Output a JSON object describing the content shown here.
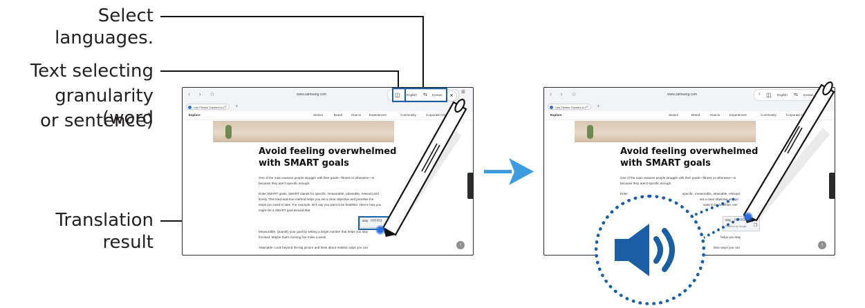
{
  "callouts": {
    "select_languages": "Select languages.",
    "granularity_line1": "Text selecting",
    "granularity_line2": "granularity (word",
    "granularity_line3": "or sentence)",
    "translation_result": "Translation result"
  },
  "colors": {
    "accent": "#1a5fa3",
    "arrow": "#3d9be0",
    "highlight": "#2c6fe0"
  },
  "browser": {
    "url": "www.samsung.com",
    "tab_title": "Use Fitness Trackers to F...",
    "menu": {
      "explore": "Explore",
      "items": [
        "Stories",
        "Brand",
        "How-to",
        "Experiences",
        "Community",
        "Corporate Citizenship"
      ]
    }
  },
  "translation_bar": {
    "source_language": "English",
    "swap_icon": "swap-arrows-icon",
    "target_language": "Korean",
    "granularity_icon": "text-select-mode-icon",
    "close_icon": "close-icon",
    "speaker_icon": "speaker-icon"
  },
  "article": {
    "heading_line1": "Avoid feeling overwhelmed",
    "heading_line2": "with SMART goals",
    "left_lines": [
      "One of the main reasons people struggle with their goals—fitness or otherwise—is",
      "because they aren't specific enough.",
      "Enter SMART goals. SMART stands for specific, measurable, attainable, relevant and",
      "timely. This tried-and-true method helps you set a clear objective and prioritise the",
      "steps you need to take. For example, let's say you want to be healthier. Here's how you",
      "might set a SMART goal around that.",
      "Measurable. Quantify your goal by setting a target number that helps you stay",
      "focused. Maybe that's running five miles a week.",
      "Attainable: Look beyond the big picture and think about realistic ways you can"
    ],
    "right_lines": [
      "One of the main reasons people struggle with their goals—fitness or otherwise—is",
      "because they aren't specific enough.",
      "Enter",
      "specific, measurable, attainable, relevant",
      "set a clear objective and pri",
      "want to be healthier. Her",
      "helps you stay",
      "listic ways you can"
    ]
  },
  "popup": {
    "word": "stay",
    "translation": "머무르다",
    "source": "Powered by Google"
  },
  "icons": {
    "scroll_top": "arrow-up-icon",
    "next": "arrow-right-icon"
  }
}
